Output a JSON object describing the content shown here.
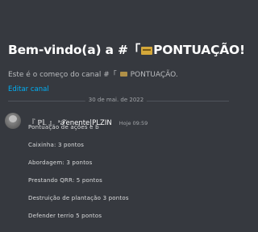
{
  "welcome": {
    "title_prefix": "Bem-vindo(a) a #「",
    "title_channel": "PONTUAÇÃO!",
    "subtitle_prefix": "Este é o começo do canal #「",
    "subtitle_channel": "PONTUAÇÃO.",
    "edit_link": "Editar canal"
  },
  "divider": {
    "date": "30 de mai. de 2022"
  },
  "message": {
    "author": "『 ℙ𝕃 』 ᵃ𝓣enente|PLZIN",
    "timestamp": "Hoje 09:59",
    "lines": [
      "Pontuação de ações e b",
      "Caixinha: 3 pontos",
      "Abordagem: 3 pontos",
      "Prestando QRR: 5 pontos",
      "Destruição de plantação 3 pontos",
      "Defender terrio 5 pontos"
    ]
  },
  "colors": {
    "background": "#36393f",
    "link": "#00aff4",
    "title": "#ffffff",
    "muted": "#b9bbbe"
  }
}
